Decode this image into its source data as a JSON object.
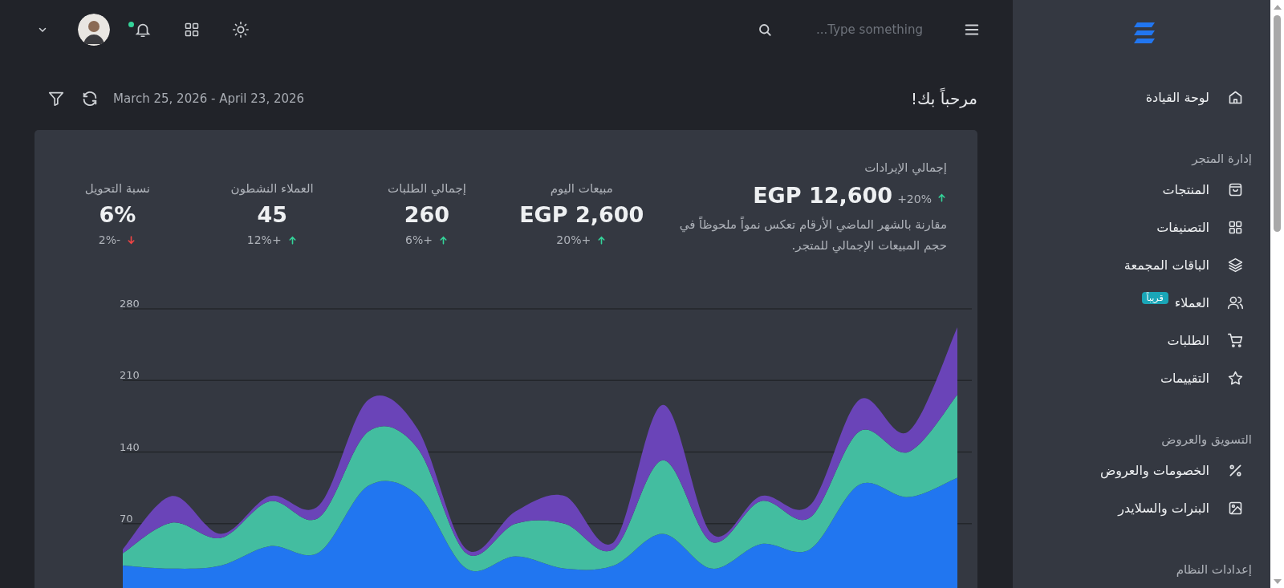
{
  "topbar": {
    "search": {
      "placeholder": "Type something..."
    },
    "notifications": {
      "unread": true
    }
  },
  "header": {
    "title": "مرحباً بك!",
    "date_range": "March 25, 2026 - April 23, 2026"
  },
  "revenue": {
    "label": "إجمالي الإيرادات",
    "value": "EGP 12,600",
    "change": "+20%",
    "kind": "up",
    "description": "مقارنة بالشهر الماضي الأرقام تعكس نمواً ملحوظاً في حجم المبيعات الإجمالي للمتجر."
  },
  "stats": [
    {
      "label": "مبيعات اليوم",
      "value": "EGP 2,600",
      "change": "+20%",
      "kind": "up"
    },
    {
      "label": "إجمالي الطلبات",
      "value": "260",
      "change": "+6%",
      "kind": "up"
    },
    {
      "label": "العملاء النشطون",
      "value": "45",
      "change": "+12%",
      "kind": "up"
    },
    {
      "label": "نسبة التحويل",
      "value": "6%",
      "change": "-2%",
      "kind": "down"
    }
  ],
  "chart_data": {
    "type": "area",
    "stacked": true,
    "grid": true,
    "ylim": [
      0,
      280
    ],
    "yticks": [
      70,
      140,
      210,
      280
    ],
    "series": [
      {
        "color": "#2176f0",
        "values": [
          29,
          26,
          29,
          48,
          42,
          107,
          98,
          26,
          38,
          26,
          29,
          60,
          26,
          50,
          45,
          108,
          96,
          115
        ]
      },
      {
        "color": "#43bda0",
        "values": [
          12,
          45,
          27,
          44,
          34,
          53,
          46,
          15,
          32,
          44,
          16,
          72,
          26,
          42,
          31,
          52,
          44,
          81
        ]
      },
      {
        "color": "#6a44b8",
        "values": [
          4,
          26,
          4,
          5,
          12,
          31,
          19,
          4,
          12,
          27,
          7,
          54,
          8,
          5,
          12,
          31,
          20,
          66
        ]
      }
    ]
  },
  "sidebar": {
    "sections": [
      {
        "items": [
          {
            "label": "لوحة القيادة"
          }
        ]
      },
      {
        "title": "إدارة المتجر",
        "items": [
          {
            "label": "المنتجات"
          },
          {
            "label": "التصنيفات"
          },
          {
            "label": "الباقات المجمعة"
          },
          {
            "label": "العملاء",
            "badge": "قريباً"
          },
          {
            "label": "الطلبات"
          },
          {
            "label": "التقييمات"
          }
        ]
      },
      {
        "title": "التسويق والعروض",
        "items": [
          {
            "label": "الخصومات والعروض"
          },
          {
            "label": "البنرات والسلايدر"
          }
        ]
      },
      {
        "title": "إعدادات النظام"
      }
    ]
  }
}
